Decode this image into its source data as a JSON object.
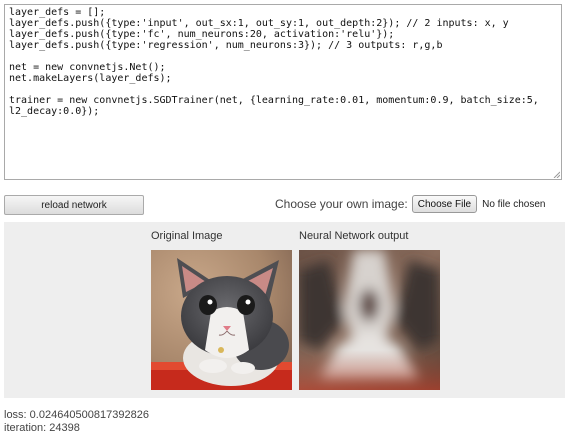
{
  "code": {
    "lines": [
      "layer_defs = [];",
      "layer_defs.push({type:'input', out_sx:1, out_sy:1, out_depth:2}); // 2 inputs: x, y",
      "layer_defs.push({type:'fc', num_neurons:20, activation:'relu'});",
      "layer_defs.push({type:'regression', num_neurons:3}); // 3 outputs: r,g,b",
      "",
      "net = new convnetjs.Net();",
      "net.makeLayers(layer_defs);",
      "",
      "trainer = new convnetjs.SGDTrainer(net, {learning_rate:0.01, momentum:0.9, batch_size:5,",
      "l2_decay:0.0});"
    ]
  },
  "controls": {
    "reload_label": "reload network",
    "choose_label": "Choose your own image:",
    "choose_button": "Choose File",
    "no_file": "No file chosen"
  },
  "images": {
    "original_caption": "Original Image",
    "output_caption": "Neural Network output"
  },
  "stats": {
    "loss": "loss: 0.024640500817392826",
    "iteration": "iteration: 24398"
  }
}
